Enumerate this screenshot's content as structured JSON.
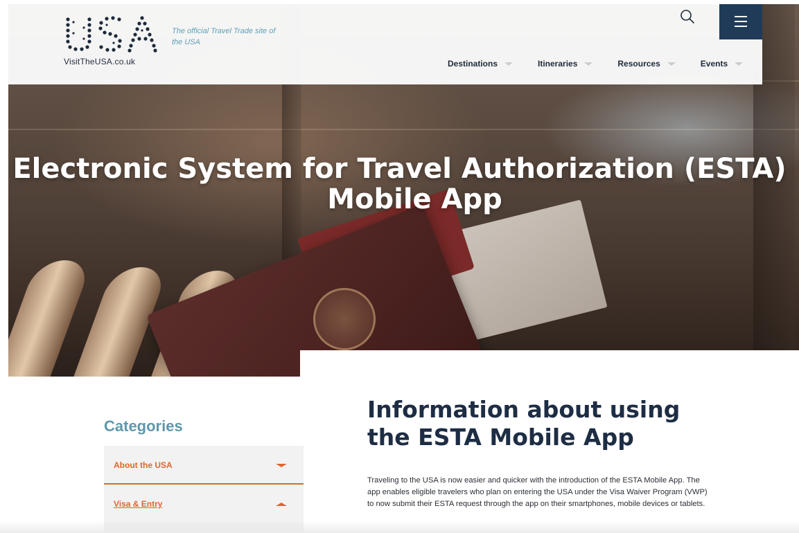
{
  "header": {
    "logo_alt": "USA",
    "logo_url_text": "VisitTheUSA.co.uk",
    "tagline": "The official Travel Trade site of the USA",
    "nav": [
      {
        "label": "Destinations"
      },
      {
        "label": "Itineraries"
      },
      {
        "label": "Resources"
      },
      {
        "label": "Events"
      }
    ],
    "search_icon": "search-icon",
    "menu_icon": "hamburger-menu-icon",
    "menu_color": "#1f3b58"
  },
  "hero": {
    "title_line1": "Electronic System for Travel Authorization (ESTA)",
    "title_line2": "Mobile App"
  },
  "sidebar": {
    "title": "Categories",
    "items": [
      {
        "label": "About the USA",
        "state": "collapsed"
      },
      {
        "label": "Visa & Entry",
        "state": "expanded"
      }
    ],
    "accent": "#e0652e",
    "title_color": "#5f97ac"
  },
  "main": {
    "heading": "Information about using the ESTA Mobile App",
    "paragraph": "Traveling to the USA is now easier and quicker with the introduction of the ESTA Mobile App. The app enables eligible travelers who plan on entering the USA under the Visa Waiver Program (VWP) to now submit their ESTA request through the app on their smartphones, mobile devices or tablets."
  }
}
